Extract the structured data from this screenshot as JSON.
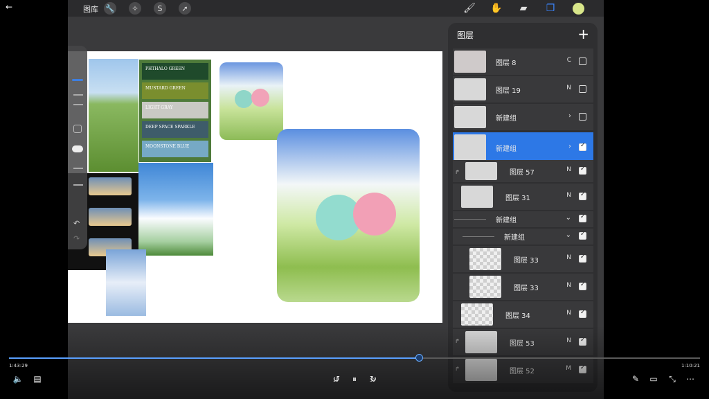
{
  "topbar": {
    "gallery_label": "图库",
    "tools_left": [
      {
        "name": "wrench-icon",
        "glyph": "🔧"
      },
      {
        "name": "magic-wand-icon",
        "glyph": "✧"
      },
      {
        "name": "selection-icon",
        "glyph": "S"
      },
      {
        "name": "transform-arrow-icon",
        "glyph": "➚"
      }
    ],
    "tools_right": [
      {
        "name": "brush-icon",
        "glyph": "🖌"
      },
      {
        "name": "smudge-icon",
        "glyph": "✋"
      },
      {
        "name": "eraser-icon",
        "glyph": "▰"
      },
      {
        "name": "layers-icon",
        "glyph": "❐"
      }
    ],
    "color_swatch": "#d8e68a"
  },
  "palette_swatches": [
    {
      "label": "PHTHALO GREEN",
      "color": "#1f4a2b"
    },
    {
      "label": "MUSTARD GREEN",
      "color": "#7a8e2e"
    },
    {
      "label": "LIGHT GRAY",
      "color": "#c9c9c4"
    },
    {
      "label": "DEEP SPACE SPARKLE",
      "color": "#3e5c6a"
    },
    {
      "label": "MOONSTONE BLUE",
      "color": "#76a9c5"
    }
  ],
  "layers_panel": {
    "title": "图层",
    "add_icon": "+",
    "rows": [
      {
        "name": "图层 8",
        "mode": "C",
        "checked": false,
        "type": "layer"
      },
      {
        "name": "图层 19",
        "mode": "N",
        "checked": false,
        "type": "layer"
      },
      {
        "name": "新建组",
        "mode": "›",
        "checked": false,
        "type": "group"
      },
      {
        "name": "新建组",
        "mode": "›",
        "checked": true,
        "type": "group-selected"
      },
      {
        "name": "图层 57",
        "mode": "N",
        "checked": true,
        "type": "clip"
      },
      {
        "name": "图层 31",
        "mode": "N",
        "checked": true,
        "type": "layer"
      },
      {
        "name": "新建组",
        "mode": "⌄",
        "checked": true,
        "type": "group-open"
      },
      {
        "name": "新建组",
        "mode": "⌄",
        "checked": true,
        "type": "subgroup-open"
      },
      {
        "name": "图层 33",
        "mode": "N",
        "checked": true,
        "type": "sublayer"
      },
      {
        "name": "图层 33",
        "mode": "N",
        "checked": true,
        "type": "sublayer"
      },
      {
        "name": "图层 34",
        "mode": "N",
        "checked": true,
        "type": "layer"
      },
      {
        "name": "图层 53",
        "mode": "N",
        "checked": true,
        "type": "clip"
      },
      {
        "name": "图层 52",
        "mode": "M",
        "checked": true,
        "type": "clip"
      }
    ]
  },
  "player": {
    "elapsed": "1:43:29",
    "remaining": "1:10:21",
    "progress": 0.593,
    "controls_left": [
      {
        "name": "volume-icon",
        "glyph": "🔈"
      },
      {
        "name": "subtitles-icon",
        "glyph": "▤"
      }
    ],
    "controls_center": [
      {
        "name": "rewind-10-icon",
        "glyph": "↺"
      },
      {
        "name": "pause-icon",
        "glyph": "⏸"
      },
      {
        "name": "forward-30-icon",
        "glyph": "↻"
      }
    ],
    "rewind_label": "10",
    "forward_label": "30",
    "controls_right": [
      {
        "name": "pen-icon",
        "glyph": "✎"
      },
      {
        "name": "miniplayer-icon",
        "glyph": "▭"
      },
      {
        "name": "collapse-icon",
        "glyph": "⤡"
      },
      {
        "name": "more-icon",
        "glyph": "⋯"
      }
    ]
  },
  "back_icon": "←"
}
